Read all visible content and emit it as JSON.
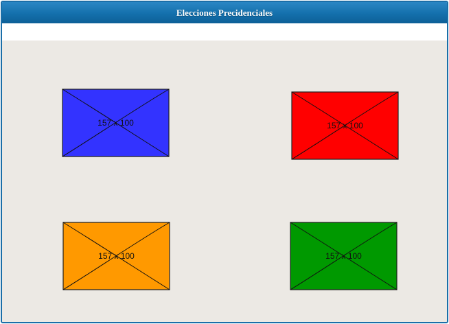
{
  "window": {
    "title": "Elecciones Precidenciales"
  },
  "candidates": [
    {
      "label": "157 x 100",
      "color": "#3333ff"
    },
    {
      "label": "157 x 100",
      "color": "#ff0000"
    },
    {
      "label": "157 x 100",
      "color": "#ff9900"
    },
    {
      "label": "157 x 100",
      "color": "#009900"
    }
  ]
}
